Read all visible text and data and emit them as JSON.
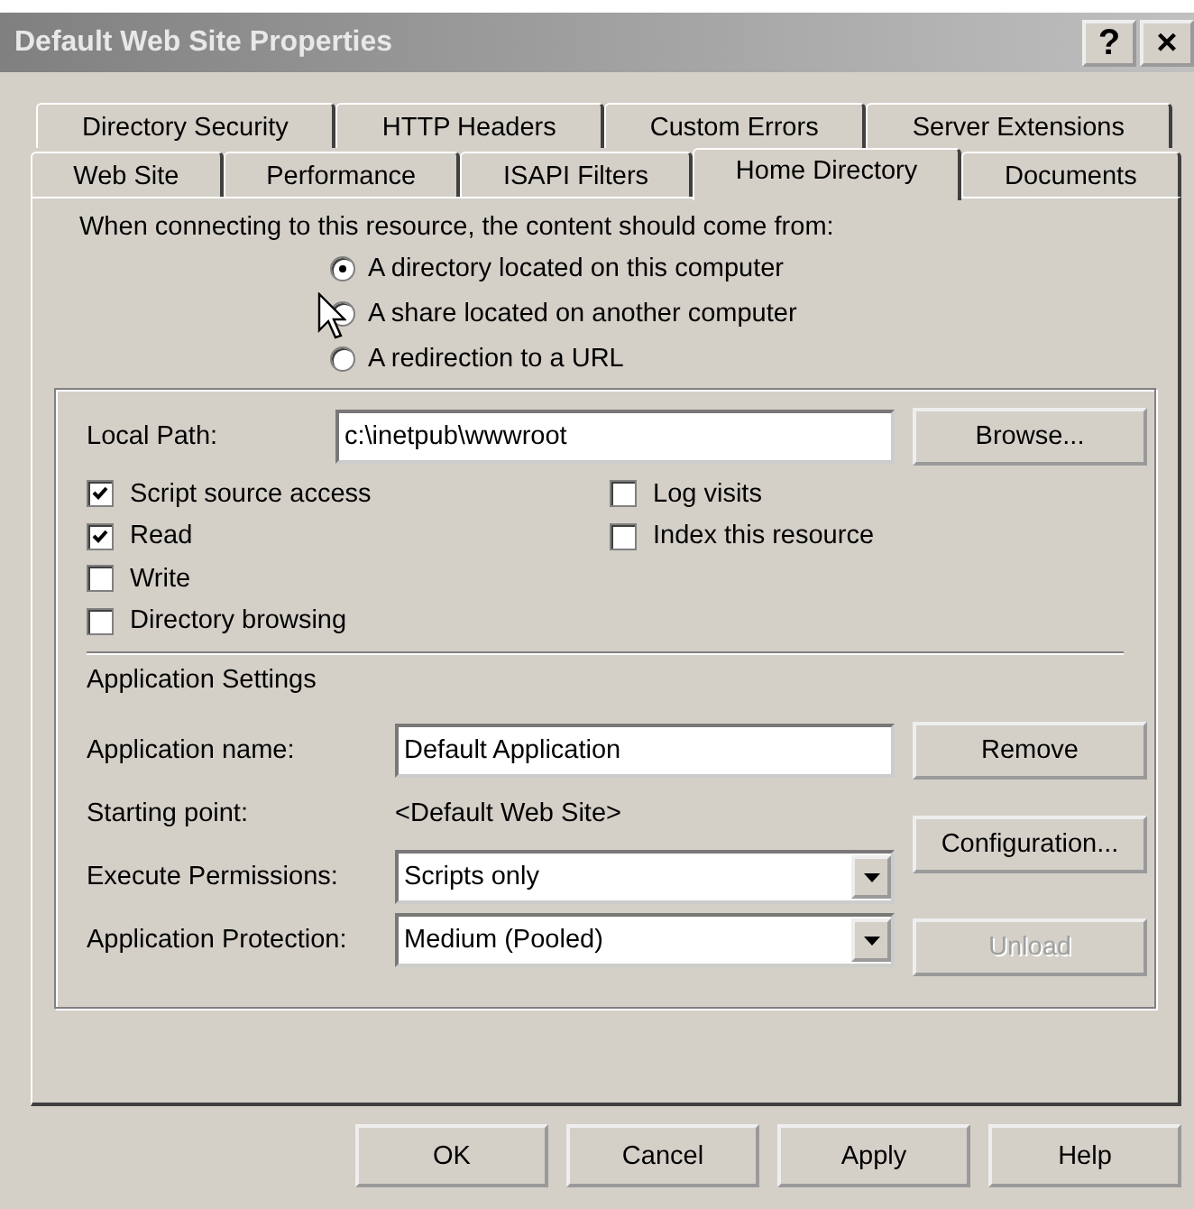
{
  "window": {
    "title": "Default Web Site Properties",
    "help_button": "?",
    "close_button": "×"
  },
  "tab_rows": [
    [
      {
        "label": "Directory Security",
        "selected": false
      },
      {
        "label": "HTTP Headers",
        "selected": false
      },
      {
        "label": "Custom Errors",
        "selected": false
      },
      {
        "label": "Server Extensions",
        "selected": false
      }
    ],
    [
      {
        "label": "Web Site",
        "selected": false
      },
      {
        "label": "Performance",
        "selected": false
      },
      {
        "label": "ISAPI Filters",
        "selected": false
      },
      {
        "label": "Home Directory",
        "selected": true
      },
      {
        "label": "Documents",
        "selected": false
      }
    ]
  ],
  "source": {
    "prompt": "When connecting to this resource, the content should come from:",
    "options": [
      {
        "label": "A directory located on this computer",
        "selected": true
      },
      {
        "label": "A share located on another computer",
        "selected": false
      },
      {
        "label": "A redirection to a URL",
        "selected": false
      }
    ]
  },
  "local_path": {
    "label": "Local Path:",
    "value": "c:\\inetpub\\wwwroot",
    "button": "Browse..."
  },
  "left_checkboxes": [
    {
      "label": "Script source access",
      "checked": true
    },
    {
      "label": "Read",
      "checked": true
    },
    {
      "label": "Write",
      "checked": false
    },
    {
      "label": "Directory browsing",
      "checked": false
    }
  ],
  "right_checkboxes": [
    {
      "label": "Log visits",
      "checked": false
    },
    {
      "label": "Index this resource",
      "checked": false
    }
  ],
  "app_settings": {
    "heading": "Application Settings",
    "name": {
      "label": "Application name:",
      "value": "Default Application",
      "button": "Remove",
      "disabled": false
    },
    "starting_point": {
      "label": "Starting point:",
      "value": "<Default Web Site>",
      "button": "Configuration...",
      "disabled": false
    },
    "execute": {
      "label": "Execute Permissions:",
      "value": "Scripts only"
    },
    "protection": {
      "label": "Application Protection:",
      "value": "Medium (Pooled)",
      "button": "Unload",
      "disabled": true
    }
  },
  "buttons": [
    {
      "label": "OK",
      "disabled": false
    },
    {
      "label": "Cancel",
      "disabled": false
    },
    {
      "label": "Apply",
      "disabled": false
    },
    {
      "label": "Help",
      "disabled": false
    }
  ]
}
